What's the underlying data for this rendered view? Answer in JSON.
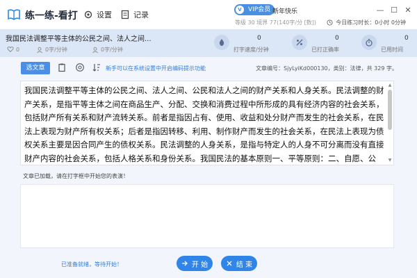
{
  "titlebar": {
    "app_title": "练一练-看打",
    "settings_label": "设置",
    "records_label": "记录",
    "vip_badge": "VIP会员",
    "vip_icon_text": "V",
    "greeting": "新年快乐",
    "user_stats": "等级 30 境界 77(140字/分 [数])",
    "today_stats": "今日练习时长：0小时 0分钟",
    "minimize": "—",
    "maximize": "☐",
    "close": "✕"
  },
  "article_bar": {
    "title": "我国民法调整平等主体的公民之间、法人之间...",
    "likes": "0",
    "speed_a": "0字/分钟",
    "speed_b": "0字/分钟",
    "typing_speed": {
      "label": "打字速度/分钟",
      "value": "0"
    },
    "typed_correct": {
      "label": "已打正确率",
      "value": "0"
    },
    "time_used": {
      "label": "已用时间",
      "value": "0"
    }
  },
  "toolbar": {
    "pick_article": "选文章",
    "tip": "新手可以在系统设置中开启编码提示功能",
    "article_info": "文章编号：SjyLyiKd000130，类别：法律，共 329 字。"
  },
  "article_text": "我国民法调整平等主体的公民之间、法人之间、公民和法人之间的财产关系和人身关系。民法调整的财产关系，是指平等主体之间在商品生产、分配、交换和消费过程中所形成的具有经济内容的社会关系，包括财产所有关系和财产流转关系。前者是指因占有、使用、收益和处分财产而发生的社会关系，在民法上表现为财产所有权关系；后者是指因转移、利用、制作财产而发生的社会关系，在民法上表现为债权关系主要是因合同产生的债权关系。民法调整的人身关系，是指与特定人的人身不可分离而没有直接财产内容的社会关系，包括人格关系和身份关系。我国民法的基本原则一、平等原则：二、自愿、公平、等价有偿、诚实信用原则。",
  "messages": {
    "loaded": "文章已加载，请在打字框中开始您的表演！",
    "status": "已准备就绪，等待开始！"
  },
  "actions": {
    "start": "开 始",
    "end": "结 束"
  },
  "colors": {
    "accent": "#2f86e8",
    "header_band": "#dbe6f7",
    "background": "#f2f6fc"
  }
}
